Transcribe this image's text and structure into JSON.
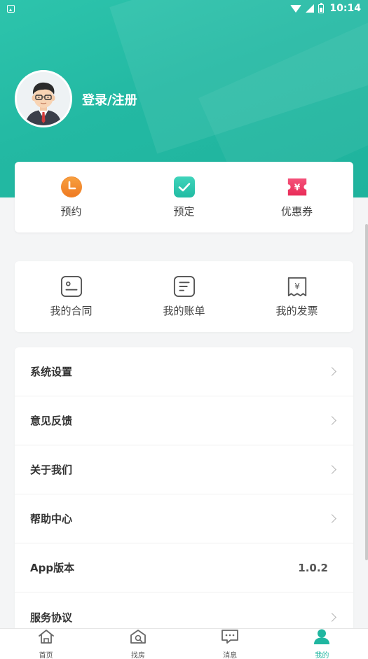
{
  "status_bar": {
    "time": "10:14"
  },
  "profile": {
    "login_label": "登录/注册"
  },
  "quick_actions": [
    {
      "label": "预约",
      "icon": "clock-icon",
      "color": "#f28a2e"
    },
    {
      "label": "预定",
      "icon": "check-icon",
      "color": "#2ec7af"
    },
    {
      "label": "优惠券",
      "icon": "coupon-icon",
      "color": "#ef3b66"
    }
  ],
  "services": [
    {
      "label": "我的合同",
      "icon": "contract-icon"
    },
    {
      "label": "我的账单",
      "icon": "bill-icon"
    },
    {
      "label": "我的发票",
      "icon": "invoice-icon"
    }
  ],
  "menu": [
    {
      "label": "系统设置"
    },
    {
      "label": "意见反馈"
    },
    {
      "label": "关于我们"
    },
    {
      "label": "帮助中心"
    },
    {
      "label": "App版本",
      "value": "1.0.2"
    },
    {
      "label": "服务协议"
    }
  ],
  "bottom_nav": [
    {
      "label": "首页",
      "icon": "home-icon"
    },
    {
      "label": "找房",
      "icon": "find-house-icon"
    },
    {
      "label": "消息",
      "icon": "message-icon"
    },
    {
      "label": "我的",
      "icon": "profile-icon",
      "active": true
    }
  ],
  "colors": {
    "brand": "#20b6a0",
    "header": "#23b9a3"
  }
}
